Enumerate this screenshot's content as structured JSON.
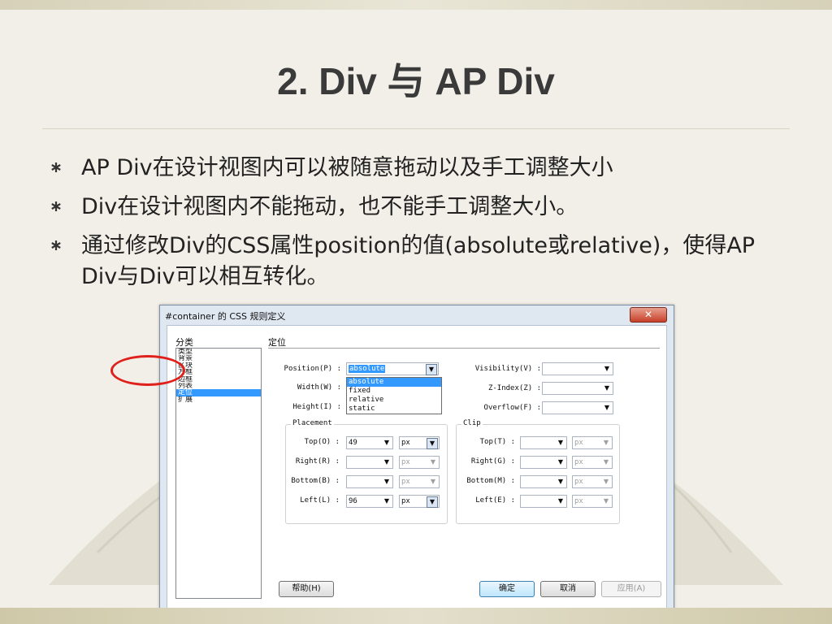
{
  "slide": {
    "title": "2. Div 与 AP Div",
    "bullets": [
      "AP Div在设计视图内可以被随意拖动以及手工调整大小",
      "Div在设计视图内不能拖动，也不能手工调整大小。",
      "通过修改Div的CSS属性position的值(absolute或relative)，使得AP Div与Div可以相互转化。"
    ]
  },
  "dialog": {
    "title": "#container 的 CSS 规则定义",
    "close_label": "✕",
    "category_header": "分类",
    "categories": [
      "类型",
      "背景",
      "区块",
      "方框",
      "边框",
      "列表",
      "定位",
      "扩展"
    ],
    "selected_category": "定位",
    "section_title": "定位",
    "position": {
      "label": "Position(P) :",
      "value": "absolute",
      "options": [
        "absolute",
        "fixed",
        "relative",
        "static"
      ]
    },
    "width_label": "Width(W) :",
    "height_label": "Height(I) :",
    "visibility_label": "Visibility(V) :",
    "zindex_label": "Z-Index(Z) :",
    "overflow_label": "Overflow(F) :",
    "placement": {
      "legend": "Placement",
      "top_label": "Top(O) :",
      "top_value": "49",
      "top_unit": "px",
      "right_label": "Right(R) :",
      "right_value": "",
      "right_unit": "px",
      "bottom_label": "Bottom(B) :",
      "bottom_value": "",
      "bottom_unit": "px",
      "left_label": "Left(L) :",
      "left_value": "96",
      "left_unit": "px"
    },
    "clip": {
      "legend": "Clip",
      "top_label": "Top(T) :",
      "top_unit": "px",
      "right_label": "Right(G) :",
      "right_unit": "px",
      "bottom_label": "Bottom(M) :",
      "bottom_unit": "px",
      "left_label": "Left(E) :",
      "left_unit": "px"
    },
    "buttons": {
      "help": "帮助(H)",
      "ok": "确定",
      "cancel": "取消",
      "apply": "应用(A)"
    },
    "arrow_glyph": "▼"
  }
}
